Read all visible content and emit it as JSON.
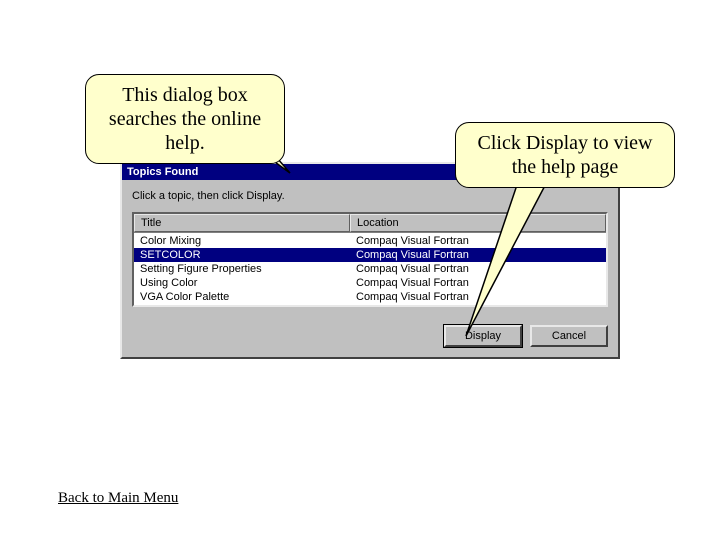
{
  "callouts": {
    "left": "This dialog box searches the online help.",
    "right": "Click Display to view the help page"
  },
  "dialog": {
    "title": "Topics Found",
    "instruction": "Click a topic, then click Display.",
    "columns": {
      "title": "Title",
      "location": "Location"
    },
    "rows": [
      {
        "title": "Color Mixing",
        "location": "Compaq Visual Fortran",
        "selected": false
      },
      {
        "title": "SETCOLOR",
        "location": "Compaq Visual Fortran",
        "selected": true
      },
      {
        "title": "Setting Figure Properties",
        "location": "Compaq Visual Fortran",
        "selected": false
      },
      {
        "title": "Using Color",
        "location": "Compaq Visual Fortran",
        "selected": false
      },
      {
        "title": "VGA Color Palette",
        "location": "Compaq Visual Fortran",
        "selected": false
      }
    ],
    "buttons": {
      "display": "Display",
      "cancel": "Cancel"
    }
  },
  "back_link": "Back to Main Menu"
}
